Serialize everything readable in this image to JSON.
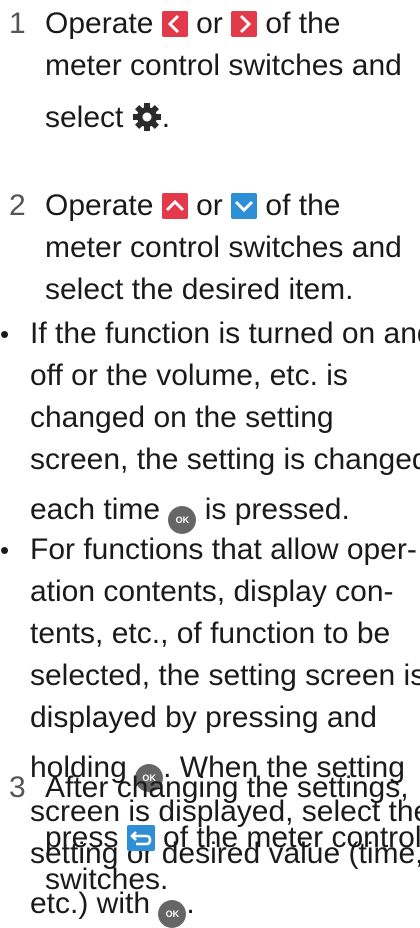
{
  "step1": {
    "number": "1",
    "line1_a": "Operate ",
    "line1_b": " or ",
    "line1_c": " of the",
    "line2": "meter control switches and",
    "line3_a": "select ",
    "line3_b": "."
  },
  "step2": {
    "number": "2",
    "line1_a": "Operate ",
    "line1_b": " or ",
    "line1_c": " of the",
    "line2": "meter control switches and",
    "line3": "select the desired item."
  },
  "bullet1": {
    "l1": "If the function is turned on and",
    "l2": "off or the volume, etc. is",
    "l3": "changed on the setting",
    "l4": "screen, the setting is changed",
    "l5_a": "each time ",
    "l5_b": " is pressed."
  },
  "bullet2": {
    "l1": "For functions that allow oper-",
    "l2": "ation contents, display con-",
    "l3": "tents, etc., of function to be",
    "l4": "selected, the setting screen is",
    "l5": "displayed by pressing and",
    "l6_a": "holding ",
    "l6_b": ". When the setting",
    "l7": "screen is displayed, select the",
    "l8": "setting or desired value (time,",
    "l9_a": "etc.) with ",
    "l9_b": "."
  },
  "step3": {
    "number": "3",
    "line1": "After changing the settings,",
    "line2_a": "press ",
    "line2_b": " of the meter control",
    "line3": "switches."
  },
  "bullet_char": "•",
  "ok_label": "OK",
  "icons": {
    "left": "left-arrow-icon",
    "right": "right-arrow-icon",
    "up": "up-arrow-icon",
    "down": "down-arrow-icon",
    "gear": "gear-icon",
    "ok": "ok-button-icon",
    "back": "back-icon"
  },
  "colors": {
    "arrow_red": "#e33a4b",
    "arrow_blue": "#2f8fd6",
    "ok_gray": "#666666"
  }
}
